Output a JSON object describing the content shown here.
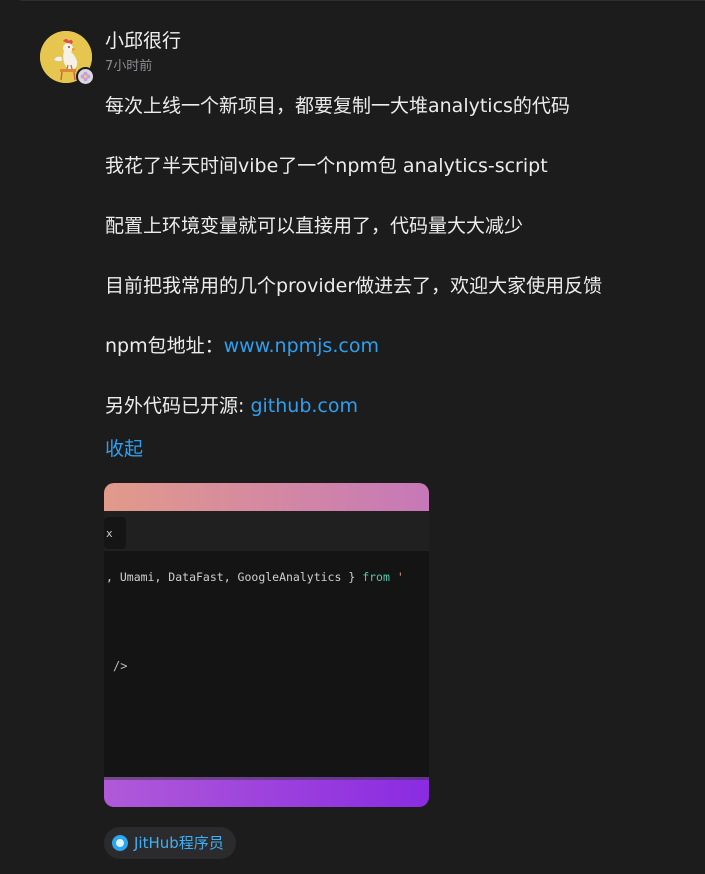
{
  "post": {
    "author": "小邱很行",
    "time": "7小时前",
    "lines": [
      "每次上线一个新项目，都要复制一大堆analytics的代码",
      "我花了半天时间vibe了一个npm包 analytics-script",
      "配置上环境变量就可以直接用了，代码量大大减少",
      "目前把我常用的几个provider做进去了，欢迎大家使用反馈"
    ],
    "npm_prefix": "npm包地址：",
    "npm_link": "www.npmjs.com",
    "github_prefix": "另外代码已开源: ",
    "github_link": "github.com",
    "collapse_label": "收起",
    "topic": "JitHub程序员"
  },
  "screenshot": {
    "code_line": ", Umami, DataFast, GoogleAnalytics } from '",
    "tag_close": "/>",
    "tab_mark": "x"
  },
  "colors": {
    "background": "#1c1c1d",
    "link": "#2f9fee",
    "avatar": "#e6c64f",
    "gradient_top": [
      "#e29a8a",
      "#c678b8"
    ],
    "gradient_bottom": [
      "#b05ad8",
      "#8a2be2"
    ]
  },
  "icons": {
    "avatar": "rooster-avatar-icon",
    "badge": "flower-badge-icon",
    "topic": "topic-circle-icon"
  }
}
